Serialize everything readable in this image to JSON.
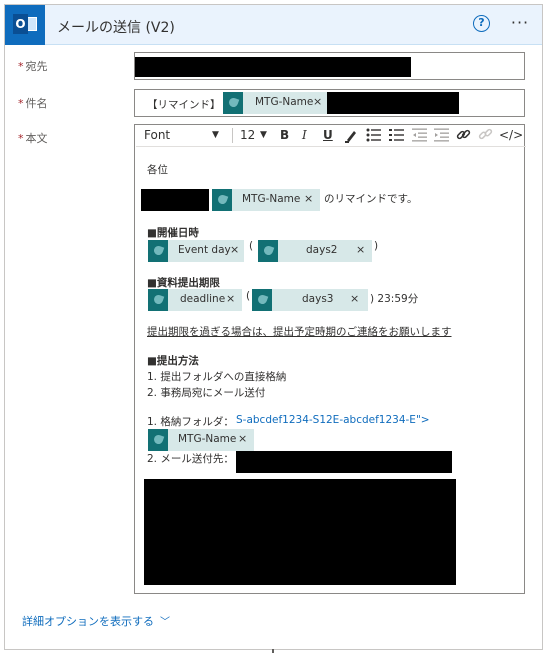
{
  "header": {
    "title": "メールの送信 (V2)",
    "help_glyph": "?",
    "more_glyph": "···",
    "app_icon_letter": "O"
  },
  "fields": {
    "to_label": "宛先",
    "subject_label": "件名",
    "body_label": "本文",
    "required_mark": "*"
  },
  "subject": {
    "prefix": "【リマインド】",
    "token": "MTG-Name"
  },
  "toolbar": {
    "font": "Font",
    "size": "12",
    "dropdown_glyph": "▼",
    "bold": "B",
    "italic": "I",
    "underline": "U",
    "code": "</>"
  },
  "body": {
    "greeting": "各位",
    "line1_token": "MTG-Name",
    "line1_suffix": "のリマインドです。",
    "datetime_heading": "■開催日時",
    "event_day_token": "Event day",
    "paren_open": "(",
    "paren_close": ")",
    "days2_token": "days2",
    "deadline_heading": "■資料提出期限",
    "deadline_token": "deadline",
    "days3_token": "days3",
    "deadline_time": ") 23:59分",
    "notice": "提出期限を過ぎる場合は、提出予定時期のご連絡をお願いします",
    "method_heading": "■提出方法",
    "method1": "1.  提出フォルダへの直接格納",
    "method2": "2.  事務局宛にメール送付",
    "folder_label": "1.  格納フォルダ：",
    "folder_link": "S-abcdef1234-S12E-abcdef1234-E\">",
    "folder_token": "MTG-Name",
    "mail_label": "2.  メール送付先："
  },
  "chip_close": "×",
  "advanced": {
    "label": "詳細オプションを表示する",
    "chevron": "﹀"
  },
  "colors": {
    "accent": "#0f6cbd",
    "header_bg": "#eaf3fd",
    "token_icon": "#127074",
    "token_bg": "#d7e8e8"
  }
}
